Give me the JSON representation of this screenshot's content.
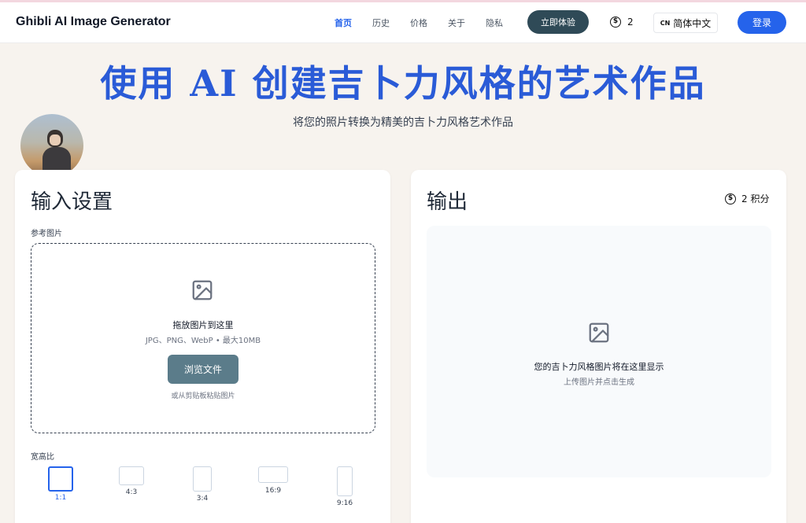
{
  "header": {
    "brand": "Ghibli AI Image Generator",
    "nav": [
      "首页",
      "历史",
      "价格",
      "关于",
      "隐私"
    ],
    "try_label": "立即体验",
    "credits": "2",
    "lang_code": "CN",
    "lang_label": "简体中文",
    "login_label": "登录"
  },
  "hero": {
    "title": "使用 AI 创建吉卜力风格的艺术作品",
    "subtitle": "将您的照片转换为精美的吉卜力风格艺术作品"
  },
  "input": {
    "title": "输入设置",
    "ref_label": "参考图片",
    "drop_title": "拖放图片到这里",
    "formats": "JPG、PNG、WebP • 最大10MB",
    "browse_label": "浏览文件",
    "paste_hint": "或从剪贴板粘贴图片",
    "ratio_label": "宽高比",
    "ratios": [
      "1:1",
      "4:3",
      "3:4",
      "16:9",
      "9:16"
    ],
    "selected_ratio": "1:1"
  },
  "output": {
    "title": "输出",
    "credits": "2 积分",
    "placeholder_title": "您的吉卜力风格图片将在这里显示",
    "placeholder_sub": "上传图片并点击生成"
  },
  "colors": {
    "accent": "#2563eb",
    "try_button": "#2f4a57",
    "browse_button": "#5b7c8a",
    "background": "#f7f3ee"
  }
}
